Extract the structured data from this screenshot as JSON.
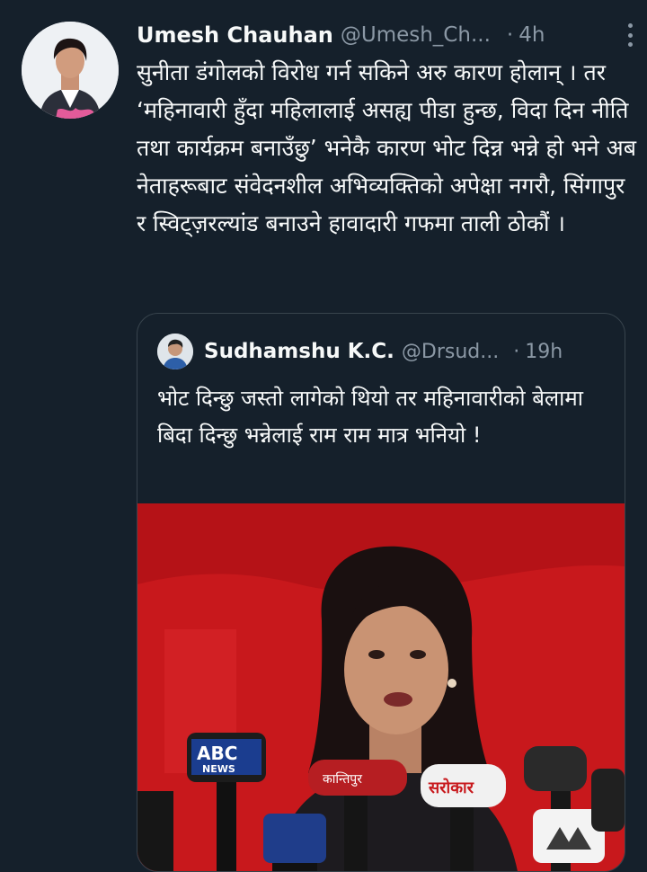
{
  "tweet": {
    "author_name": "Umesh Chauhan",
    "author_handle": "@Umesh_Ch...",
    "separator": "·",
    "time": "4h",
    "text": "सुनीता डंगोलको विरोध गर्न सकिने अरु कारण होलान् । तर ‘महिनावारी हुँदा महिलालाई असह्य पीडा हुन्छ, विदा दिन नीति तथा कार्यक्रम बनाउँछु’ भनेकै कारण भोट दिन्न भन्ने हो भने अब नेताहरूबाट संवेदनशील अभिव्यक्तिको अपेक्षा नगरौ, सिंगापुर र स्विट्ज़रल्यांड बनाउने हावादारी गफमा ताली ठोकौं ।",
    "more_icon": "more-vertical-icon"
  },
  "quoted_tweet": {
    "author_name": "Sudhamshu K.C.",
    "author_handle": "@Drsud...",
    "separator": "·",
    "time": "19h",
    "text": "भोट दिन्छु जस्तो लागेको थियो तर महिनावारीको बेलामा बिदा दिन्छु भन्नेलाई राम राम मात्र भनियो !",
    "image_label": "woman speaking at press conference with microphones",
    "mic_labels": {
      "abc": "ABC",
      "abc_news": "NEWS",
      "sarokar": "सरोकार",
      "kantipur": "कान्तिपुर"
    }
  },
  "colors": {
    "background": "#15202b",
    "text": "#f7f9f9",
    "secondary": "#8b98a5",
    "border": "#38444d",
    "image_red": "#c8181c"
  }
}
